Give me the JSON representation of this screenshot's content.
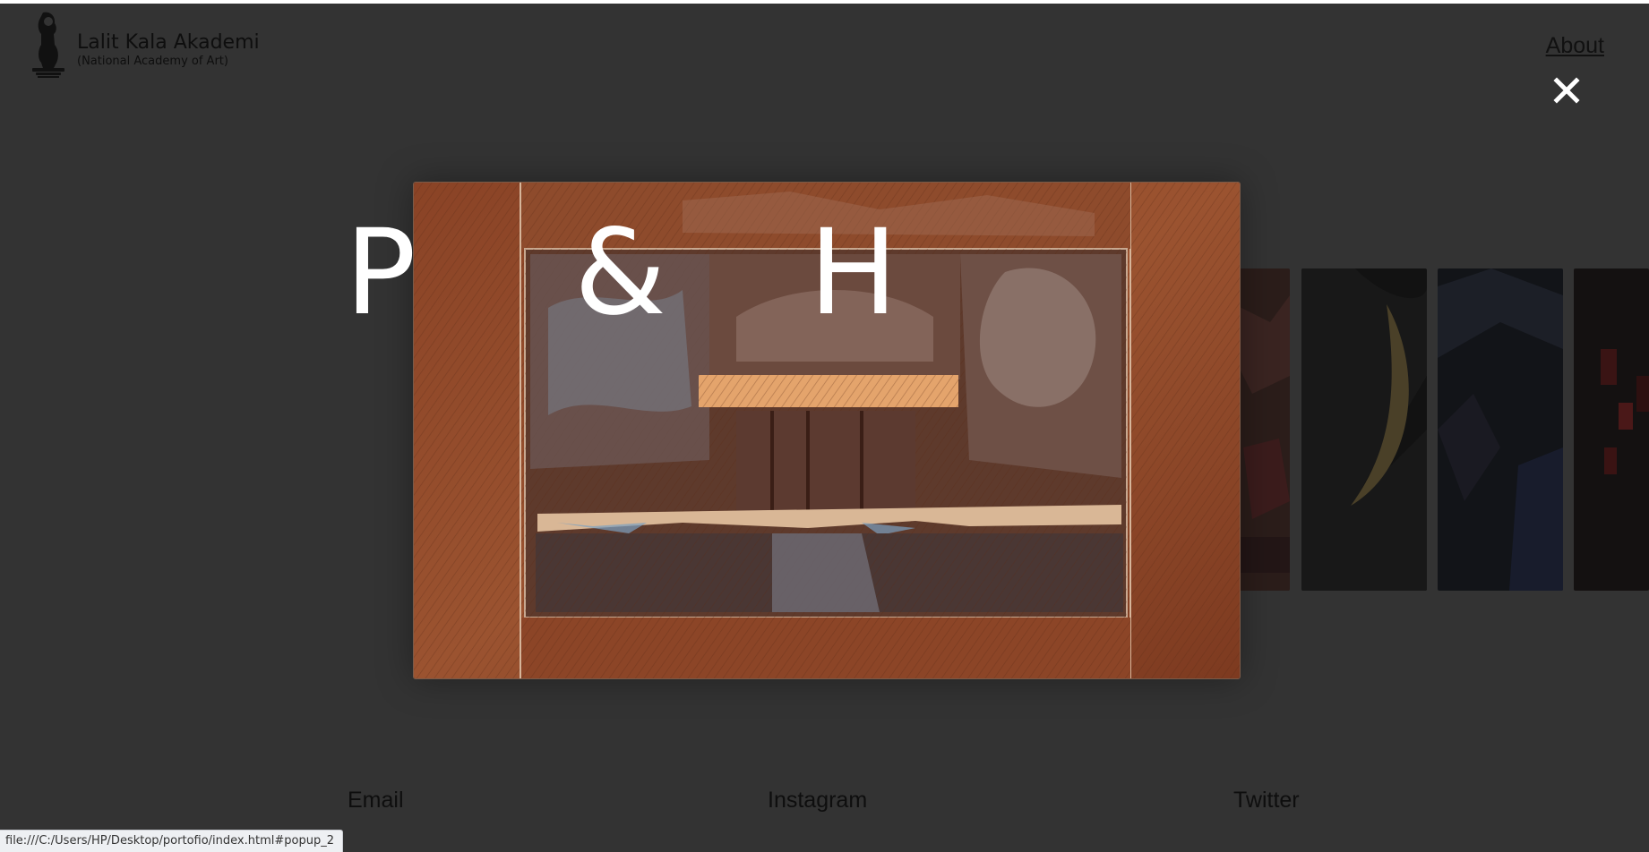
{
  "header": {
    "org_name": "Lalit Kala Akademi",
    "org_subtitle": "(National Academy of Art)",
    "about_label": "About",
    "logo_icon": "lion-emblem-icon",
    "close_icon": "close-icon"
  },
  "headline": {
    "letters": [
      "P",
      "&",
      "H"
    ]
  },
  "popup": {
    "artwork": "abstract-etching-image"
  },
  "footer": {
    "email_label": "Email",
    "instagram_label": "Instagram",
    "twitter_label": "Twitter"
  },
  "status_bar": {
    "url": "file:///C:/Users/HP/Desktop/portofio/index.html#popup_2"
  },
  "colors": {
    "background": "#333333",
    "text_dark": "#0e0e0e",
    "headline": "#ffffff",
    "artwork_primary": "#8a4a2a"
  }
}
